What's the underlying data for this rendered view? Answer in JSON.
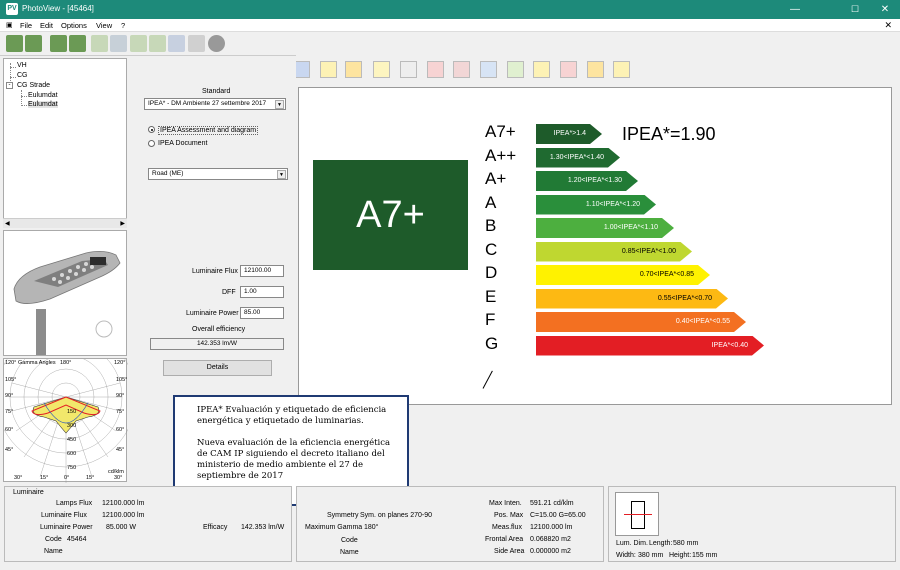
{
  "window": {
    "title": "PhotoView - [45464]",
    "app_icon": "PV"
  },
  "menu": [
    "File",
    "Edit",
    "Options",
    "View",
    "?"
  ],
  "toolbar1_icons": [
    "person-icon",
    "person-icon",
    "person-icon",
    "person-icon",
    "ies-file-icon",
    "ldt-file-icon",
    "ltli-file-icon",
    "cib-file-icon",
    "ies-file-icon",
    "cie-file-icon",
    "stop-icon"
  ],
  "toolbar2_icons": [
    "pencil-icon",
    "table-icon",
    "polar-icon",
    "cone-icon",
    "ugr-icon",
    "triangle-icon",
    "road-icon",
    "area-icon",
    "isolux-icon",
    "sheet-icon",
    "cie-icon",
    "curve-icon",
    "sphere-icon",
    "grid-icon",
    "chart-icon",
    "axis-icon",
    "arc-icon",
    "mesh-icon",
    "ring-icon"
  ],
  "tree": {
    "items": [
      "VH",
      "CG",
      "CG Strade",
      "Eulumdat",
      "Eulumdat"
    ]
  },
  "polar": {
    "top_left": "120°",
    "gamma_label": "Gamma Angles",
    "top_center": "180°",
    "top_right": "120°",
    "left_ticks": [
      "105°",
      "90°",
      "75°",
      "60°",
      "45°"
    ],
    "right_ticks": [
      "105°",
      "90°",
      "75°",
      "60°",
      "45°"
    ],
    "values": [
      "150",
      "300",
      "450",
      "600",
      "750"
    ],
    "bottom_left": "30°",
    "bottom_mid_left": "15°",
    "bottom_center": "0°",
    "bottom_mid_right": "15°",
    "bottom_right": "30°",
    "unit": "cd/klm"
  },
  "controls": {
    "standard_label": "Standard",
    "standard_value": "IPEA* - DM Ambiente 27 settembre 2017",
    "radio1": "IPEA Assessment and diagram",
    "radio2": "IPEA Document",
    "road_value": "Road (ME)",
    "flux_label": "Luminaire Flux",
    "flux_value": "12100.00",
    "dff_label": "DFF",
    "dff_value": "1.00",
    "power_label": "Luminaire Power",
    "power_value": "85.00",
    "efficiency_label": "Overall efficiency",
    "efficiency_value": "142.353 lm/W",
    "details_button": "Details"
  },
  "chart": {
    "big_class": "A7+",
    "ipea_value": "IPEA*=1.90",
    "classes": [
      {
        "name": "A7+",
        "range": "IPEA*>1.4",
        "color": "#1e5b2a"
      },
      {
        "name": "A++",
        "range": "1.30<IPEA*<1.40",
        "color": "#1f6a30"
      },
      {
        "name": "A+",
        "range": "1.20<IPEA*<1.30",
        "color": "#217a35"
      },
      {
        "name": "A",
        "range": "1.10<IPEA*<1.20",
        "color": "#2a8f3b"
      },
      {
        "name": "B",
        "range": "1.00<IPEA*<1.10",
        "color": "#4daf3f"
      },
      {
        "name": "C",
        "range": "0.85<IPEA*<1.00",
        "color": "#bfd730"
      },
      {
        "name": "D",
        "range": "0.70<IPEA*<0.85",
        "color": "#fff200"
      },
      {
        "name": "E",
        "range": "0.55<IPEA*<0.70",
        "color": "#fdb913"
      },
      {
        "name": "F",
        "range": "0.40<IPEA*<0.55",
        "color": "#f37021"
      },
      {
        "name": "G",
        "range": "IPEA*<0.40",
        "color": "#e31e24"
      }
    ]
  },
  "callout": {
    "para1": "IPEA* Evaluación y etiquetado de eficiencia energética y etiquetado de luminarias.",
    "para2": "Nueva evaluación de la eficiencia energética de CAM IP siguiendo el decreto italiano del ministerio de medio ambiente el 27 de septiembre de 2017"
  },
  "bottom": {
    "group_title": "Luminaire",
    "lamps_flux_label": "Lamps Flux",
    "lamps_flux_value": "12100.000 lm",
    "lum_flux_label": "Luminaire Flux",
    "lum_flux_value": "12100.000 lm",
    "lum_power_label": "Luminaire Power",
    "lum_power_value": "85.000 W",
    "code_label": "Code",
    "code_value": "45464",
    "name_label": "Name",
    "efficacy_label": "Efficacy",
    "efficacy_value": "142.353 lm/W",
    "symmetry_label": "Symmetry",
    "symmetry_value": "Sym. on planes 270-90",
    "max_gamma_label": "Maximum Gamma",
    "max_gamma_value": "180°",
    "code2_label": "Code",
    "name2_label": "Name",
    "max_inten_label": "Max Inten.",
    "max_inten_value": "591.21  cd/klm",
    "pos_max_label": "Pos. Max",
    "pos_max_value": "C=15.00 G=65.00",
    "meas_flux_label": "Meas.flux",
    "meas_flux_value": "12100.000 lm",
    "frontal_label": "Frontal Area",
    "frontal_value": "0.068820 m2",
    "side_label": "Side Area",
    "side_value": "0.000000 m2",
    "lum_dim_label": "Lum. Dim.",
    "length_label": "Length:",
    "length_value": "580 mm",
    "width_label": "Width:",
    "width_value": "380 mm",
    "height_label": "Height:",
    "height_value": "155 mm"
  }
}
